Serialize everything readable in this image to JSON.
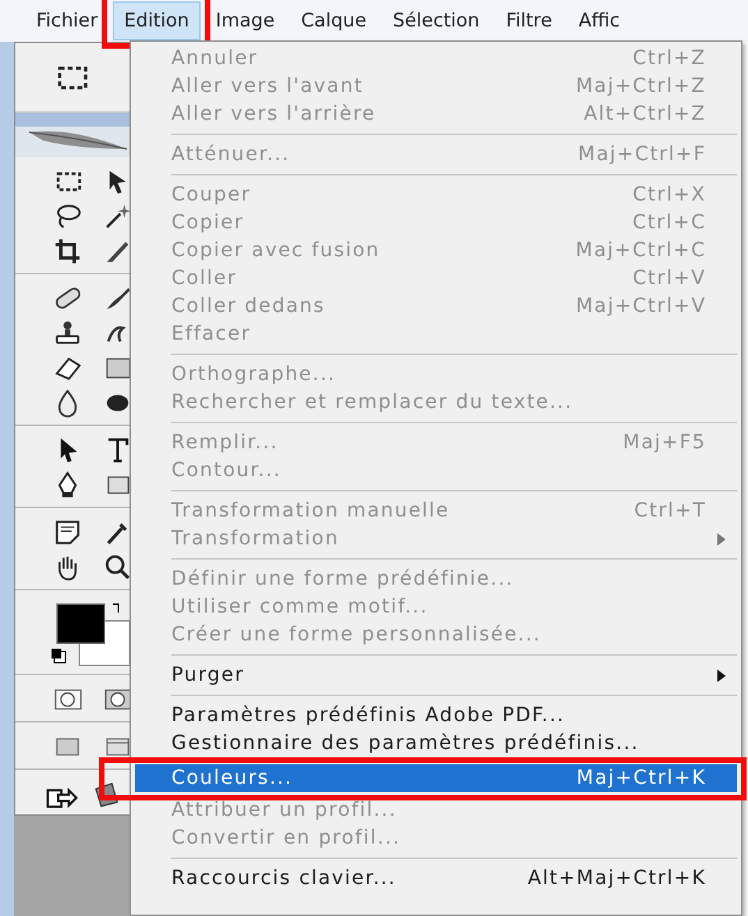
{
  "menubar": [
    {
      "label": "Fichier",
      "selected": false,
      "annotated": false
    },
    {
      "label": "Edition",
      "selected": true,
      "annotated": true
    },
    {
      "label": "Image",
      "selected": false,
      "annotated": false
    },
    {
      "label": "Calque",
      "selected": false,
      "annotated": false
    },
    {
      "label": "Sélection",
      "selected": false,
      "annotated": false
    },
    {
      "label": "Filtre",
      "selected": false,
      "annotated": false
    },
    {
      "label": "Affic",
      "selected": false,
      "annotated": false
    }
  ],
  "menu": {
    "items": [
      {
        "kind": "item",
        "label": "Annuler",
        "shortcut": "Ctrl+Z",
        "disabled": true,
        "submenu": false,
        "selected": false,
        "annotated": false
      },
      {
        "kind": "item",
        "label": "Aller vers l'avant",
        "shortcut": "Maj+Ctrl+Z",
        "disabled": true,
        "submenu": false,
        "selected": false,
        "annotated": false
      },
      {
        "kind": "item",
        "label": "Aller vers l'arrière",
        "shortcut": "Alt+Ctrl+Z",
        "disabled": true,
        "submenu": false,
        "selected": false,
        "annotated": false
      },
      {
        "kind": "separator"
      },
      {
        "kind": "item",
        "label": "Atténuer...",
        "shortcut": "Maj+Ctrl+F",
        "disabled": true,
        "submenu": false,
        "selected": false,
        "annotated": false
      },
      {
        "kind": "separator"
      },
      {
        "kind": "item",
        "label": "Couper",
        "shortcut": "Ctrl+X",
        "disabled": true,
        "submenu": false,
        "selected": false,
        "annotated": false
      },
      {
        "kind": "item",
        "label": "Copier",
        "shortcut": "Ctrl+C",
        "disabled": true,
        "submenu": false,
        "selected": false,
        "annotated": false
      },
      {
        "kind": "item",
        "label": "Copier avec fusion",
        "shortcut": "Maj+Ctrl+C",
        "disabled": true,
        "submenu": false,
        "selected": false,
        "annotated": false
      },
      {
        "kind": "item",
        "label": "Coller",
        "shortcut": "Ctrl+V",
        "disabled": true,
        "submenu": false,
        "selected": false,
        "annotated": false
      },
      {
        "kind": "item",
        "label": "Coller dedans",
        "shortcut": "Maj+Ctrl+V",
        "disabled": true,
        "submenu": false,
        "selected": false,
        "annotated": false
      },
      {
        "kind": "item",
        "label": "Effacer",
        "disabled": true,
        "submenu": false,
        "selected": false,
        "annotated": false
      },
      {
        "kind": "separator"
      },
      {
        "kind": "item",
        "label": "Orthographe...",
        "disabled": true,
        "submenu": false,
        "selected": false,
        "annotated": false
      },
      {
        "kind": "item",
        "label": "Rechercher et remplacer du texte...",
        "disabled": true,
        "submenu": false,
        "selected": false,
        "annotated": false
      },
      {
        "kind": "separator"
      },
      {
        "kind": "item",
        "label": "Remplir...",
        "shortcut": "Maj+F5",
        "disabled": true,
        "submenu": false,
        "selected": false,
        "annotated": false
      },
      {
        "kind": "item",
        "label": "Contour...",
        "disabled": true,
        "submenu": false,
        "selected": false,
        "annotated": false
      },
      {
        "kind": "separator"
      },
      {
        "kind": "item",
        "label": "Transformation manuelle",
        "shortcut": "Ctrl+T",
        "disabled": true,
        "submenu": false,
        "selected": false,
        "annotated": false
      },
      {
        "kind": "item",
        "label": "Transformation",
        "disabled": true,
        "submenu": true,
        "selected": false,
        "annotated": false
      },
      {
        "kind": "separator"
      },
      {
        "kind": "item",
        "label": "Définir une forme prédéfinie...",
        "disabled": true,
        "submenu": false,
        "selected": false,
        "annotated": false
      },
      {
        "kind": "item",
        "label": "Utiliser comme motif...",
        "disabled": true,
        "submenu": false,
        "selected": false,
        "annotated": false
      },
      {
        "kind": "item",
        "label": "Créer une forme personnalisée...",
        "disabled": true,
        "submenu": false,
        "selected": false,
        "annotated": false
      },
      {
        "kind": "separator"
      },
      {
        "kind": "item",
        "label": "Purger",
        "disabled": false,
        "submenu": true,
        "selected": false,
        "annotated": false
      },
      {
        "kind": "separator"
      },
      {
        "kind": "item",
        "label": "Paramètres prédéfinis Adobe PDF...",
        "disabled": false,
        "submenu": false,
        "selected": false,
        "annotated": false
      },
      {
        "kind": "item",
        "label": "Gestionnaire des paramètres prédéfinis...",
        "disabled": false,
        "submenu": false,
        "selected": false,
        "annotated": false
      },
      {
        "kind": "item",
        "label": "Couleurs...",
        "shortcut": "Maj+Ctrl+K",
        "disabled": false,
        "submenu": false,
        "selected": true,
        "annotated": true
      },
      {
        "kind": "item",
        "label": "Attribuer un profil...",
        "disabled": true,
        "submenu": false,
        "selected": false,
        "annotated": false
      },
      {
        "kind": "item",
        "label": "Convertir en profil...",
        "disabled": true,
        "submenu": false,
        "selected": false,
        "annotated": false
      },
      {
        "kind": "separator"
      },
      {
        "kind": "item",
        "label": "Raccourcis clavier...",
        "shortcut": "Alt+Maj+Ctrl+K",
        "disabled": false,
        "submenu": false,
        "selected": false,
        "annotated": false
      }
    ]
  }
}
